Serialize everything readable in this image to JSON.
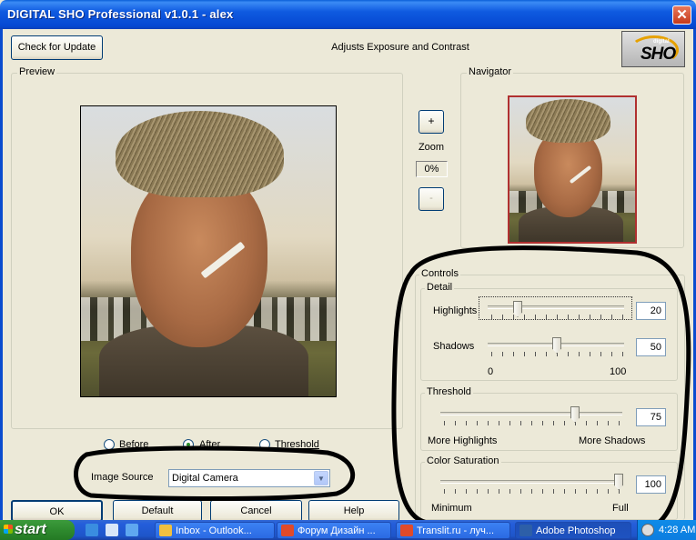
{
  "window": {
    "title": "DIGITAL SHO Professional  v1.0.1 - alex",
    "close_symbol": "✕"
  },
  "header": {
    "check_update_label": "Check for Update",
    "subtitle": "Adjusts Exposure and Contrast",
    "logo_small": "digital",
    "logo_big": "SHO"
  },
  "preview": {
    "group_label": "Preview"
  },
  "navigator": {
    "group_label": "Navigator"
  },
  "zoom": {
    "plus_label": "+",
    "label": "Zoom",
    "value": "0%",
    "minus_label": "-"
  },
  "view_mode": {
    "options": [
      "Before",
      "After",
      "Threshold"
    ],
    "selected": "After"
  },
  "image_source": {
    "label": "Image Source",
    "value": "Digital Camera"
  },
  "controls": {
    "group_label": "Controls",
    "detail": {
      "label": "Detail",
      "highlights_label": "Highlights",
      "highlights_value": "20",
      "shadows_label": "Shadows",
      "shadows_value": "50",
      "scale_min": "0",
      "scale_max": "100"
    },
    "threshold": {
      "label": "Threshold",
      "value": "75",
      "left_caption": "More Highlights",
      "right_caption": "More Shadows"
    },
    "saturation": {
      "label": "Color Saturation",
      "value": "100",
      "left_caption": "Minimum",
      "right_caption": "Full"
    }
  },
  "buttons": {
    "ok": "OK",
    "default": "Default",
    "cancel": "Cancel",
    "help": "Help"
  },
  "taskbar": {
    "start_label": "start",
    "tasks": [
      "Inbox - Outlook...",
      "Форум Дизайн ...",
      "Translit.ru - луч...",
      "Adobe Photoshop"
    ],
    "clock": "4:28 AM"
  },
  "colors": {
    "title_bar": "#0a5fd8",
    "dialog_bg": "#ece9d8",
    "annotation_ink": "#000000",
    "navigator_border": "#b03030"
  }
}
